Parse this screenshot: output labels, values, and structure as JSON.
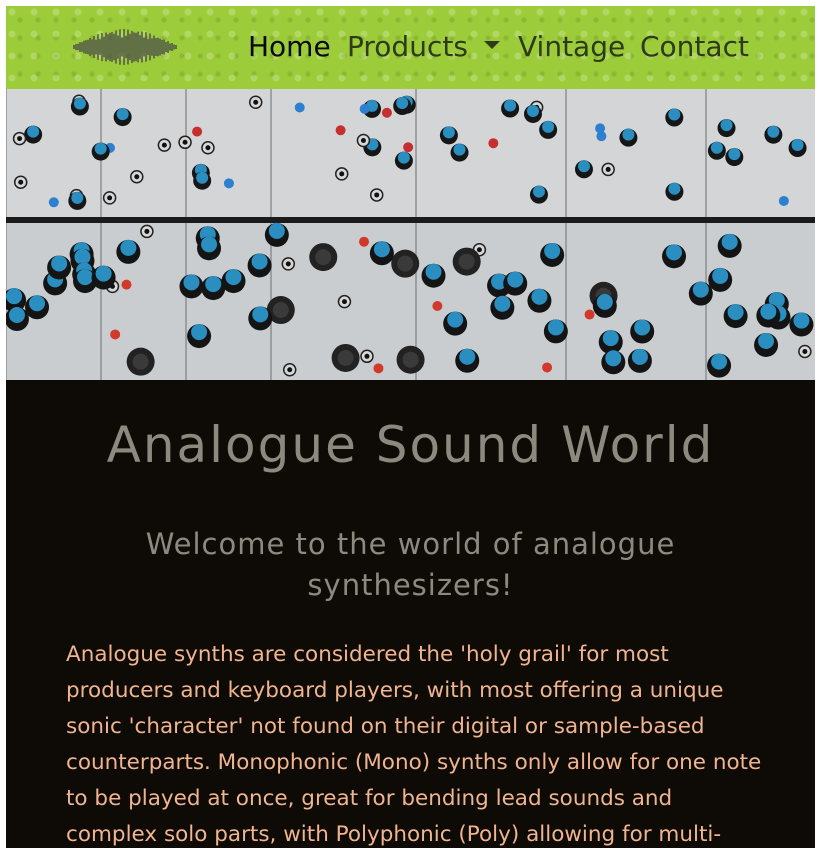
{
  "nav": {
    "logo_icon": "sound-wave-icon",
    "items": [
      {
        "label": "Home",
        "active": true
      },
      {
        "label": "Products",
        "dropdown": true
      },
      {
        "label": "Vintage"
      },
      {
        "label": "Contact"
      }
    ]
  },
  "hero": {
    "alt_icon": "modular-synth-panel-image"
  },
  "main": {
    "title": "Analogue Sound World",
    "subtitle": "Welcome to the world of analogue synthesizers!",
    "body": "Analogue synths are considered the 'holy grail' for most producers and keyboard players, with most offering a unique sonic 'character' not found on their digital or sample-based counterparts. Monophonic (Mono) synths only allow for one note to be played at once, great for bending lead sounds and complex solo parts, with Polyphonic (Poly) allowing for multi-"
  },
  "colors": {
    "navbar": "#9ccc3a",
    "page_bg": "#0e0a06",
    "title": "#8c8a7f",
    "body_text": "#f0b48f",
    "knob_blue": "#2a8fc0"
  }
}
